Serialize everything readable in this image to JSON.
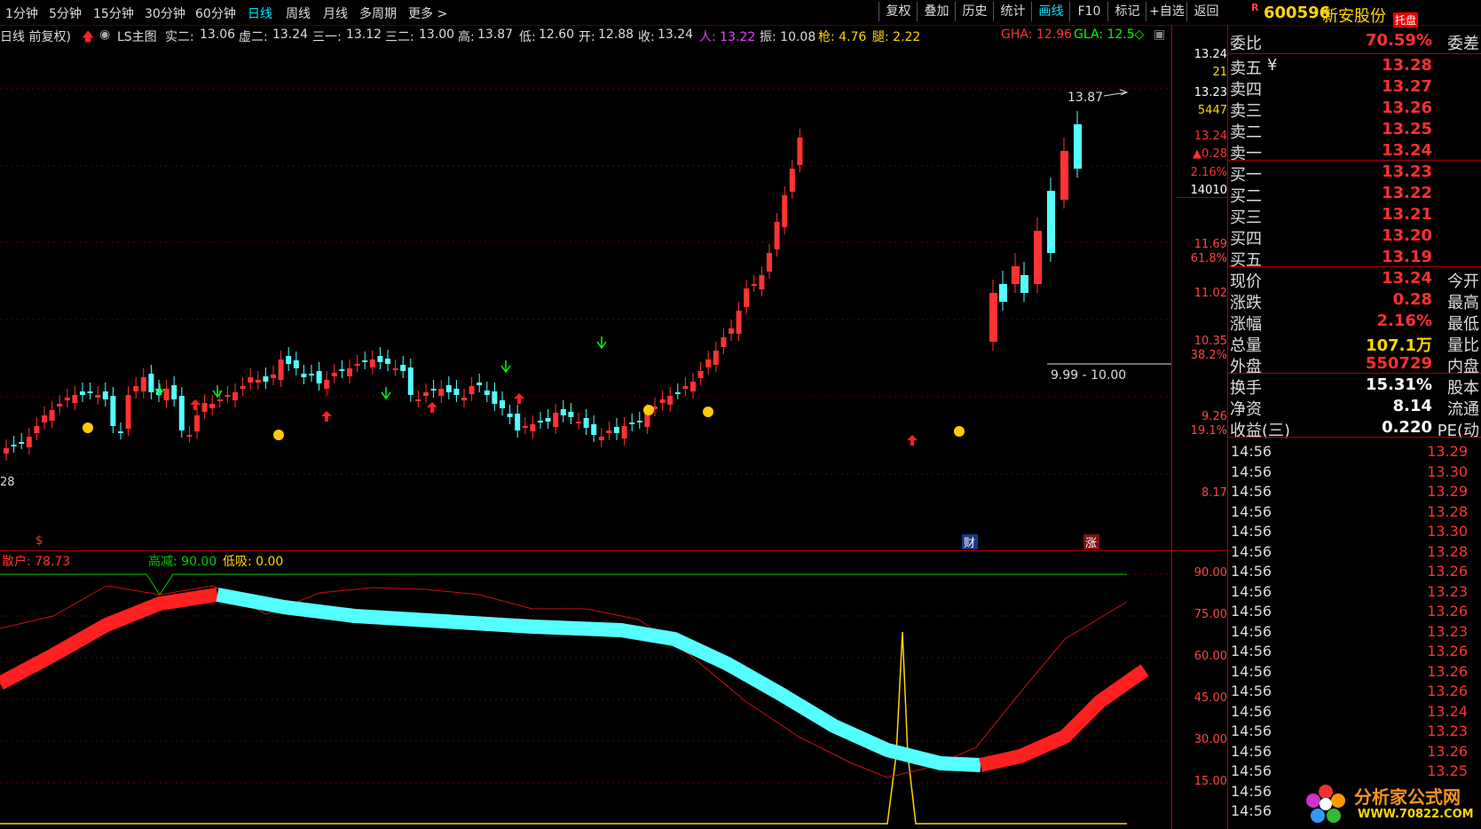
{
  "toolbar": {
    "periods": [
      "1分钟",
      "5分钟",
      "15分钟",
      "30分钟",
      "60分钟",
      "日线",
      "周线",
      "月线",
      "多周期",
      "更多 >"
    ],
    "active_period": "日线",
    "buttons": [
      "复权",
      "叠加",
      "历史",
      "统计",
      "画线",
      "F10",
      "标记",
      "+自选",
      "返回"
    ],
    "active_button": "画线"
  },
  "stock": {
    "badge": "R",
    "code": "600596",
    "name": "新安股份",
    "tag": "托盘"
  },
  "infobar": {
    "prefix": "日线 前复权)",
    "formula": "LS主图",
    "items": [
      {
        "k": "实二:",
        "v": "13.06"
      },
      {
        "k": "虚二:",
        "v": "13.24"
      },
      {
        "k": "三一:",
        "v": "13.12"
      },
      {
        "k": "三二:",
        "v": "13.00"
      },
      {
        "k": "高:",
        "v": "13.87"
      },
      {
        "k": "低:",
        "v": "12.60"
      },
      {
        "k": "开:",
        "v": "12.88"
      },
      {
        "k": "收:",
        "v": "13.24"
      }
    ],
    "ren": "人: 13.22",
    "zhen": "振: 10.08",
    "qiang": "枪: 4.76",
    "tui": "腿: 2.22",
    "gha": "GHA: 12.96",
    "gla": "GLA: 12.5◇"
  },
  "main_axis": {
    "labels": [
      "13.24",
      "21",
      "13.23",
      "5447",
      "13.24",
      "▲0.28",
      "2.16%",
      "14010",
      "11.69",
      "61.8%",
      "11.02",
      "10.35",
      "38.2%",
      "9.26",
      "19.1%",
      "8.17"
    ]
  },
  "annotations": {
    "high": "13.87",
    "range": "9.99 - 10.00",
    "left_edge": "28",
    "cai": "财",
    "zhang": "涨",
    "dollar": "$"
  },
  "indicator": {
    "sanhu": "散户: 78.73",
    "gaojian": "高减: 90.00",
    "dixi": "低吸: 0.00",
    "axis": [
      "90.00",
      "75.00",
      "60.00",
      "45.00",
      "30.00",
      "15.00"
    ]
  },
  "orderbook": {
    "weibi": {
      "label": "委比",
      "value": "70.59%",
      "label2": "委差"
    },
    "asks": [
      {
        "label": "卖五",
        "value": "13.28"
      },
      {
        "label": "卖四",
        "value": "13.27"
      },
      {
        "label": "卖三",
        "value": "13.26"
      },
      {
        "label": "卖二",
        "value": "13.25"
      },
      {
        "label": "卖一",
        "value": "13.24"
      }
    ],
    "bids": [
      {
        "label": "买一",
        "value": "13.23"
      },
      {
        "label": "买二",
        "value": "13.22"
      },
      {
        "label": "买三",
        "value": "13.21"
      },
      {
        "label": "买四",
        "value": "13.20"
      },
      {
        "label": "买五",
        "value": "13.19"
      }
    ]
  },
  "quote": [
    {
      "label": "现价",
      "value": "13.24",
      "label2": "今开",
      "color": "#ff3030"
    },
    {
      "label": "涨跌",
      "value": "0.28",
      "label2": "最高",
      "color": "#ff3030"
    },
    {
      "label": "涨幅",
      "value": "2.16%",
      "label2": "最低",
      "color": "#ff3030"
    },
    {
      "label": "总量",
      "value": "107.1万",
      "label2": "量比",
      "color": "#ffd700"
    },
    {
      "label": "外盘",
      "value": "550729",
      "label2": "内盘",
      "color": "#ff3030"
    }
  ],
  "fund": [
    {
      "label": "换手",
      "value": "15.31%",
      "label2": "股本",
      "color": "#ffffff"
    },
    {
      "label": "净资",
      "value": "8.14",
      "label2": "流通",
      "color": "#ffffff"
    },
    {
      "label": "收益(三)",
      "value": "0.220",
      "label2": "PE(动",
      "color": "#ffffff"
    }
  ],
  "ticks": [
    {
      "t": "14:56",
      "p": "13.29"
    },
    {
      "t": "14:56",
      "p": "13.30"
    },
    {
      "t": "14:56",
      "p": "13.29"
    },
    {
      "t": "14:56",
      "p": "13.28"
    },
    {
      "t": "14:56",
      "p": "13.30"
    },
    {
      "t": "14:56",
      "p": "13.28"
    },
    {
      "t": "14:56",
      "p": "13.26"
    },
    {
      "t": "14:56",
      "p": "13.23"
    },
    {
      "t": "14:56",
      "p": "13.26"
    },
    {
      "t": "14:56",
      "p": "13.23"
    },
    {
      "t": "14:56",
      "p": "13.26"
    },
    {
      "t": "14:56",
      "p": "13.26"
    },
    {
      "t": "14:56",
      "p": "13.26"
    },
    {
      "t": "14:56",
      "p": "13.24"
    },
    {
      "t": "14:56",
      "p": "13.23"
    },
    {
      "t": "14:56",
      "p": "13.26"
    },
    {
      "t": "14:56",
      "p": "13.25"
    },
    {
      "t": "14:56",
      "p": ""
    },
    {
      "t": "14:56",
      "p": ""
    }
  ],
  "watermark": {
    "cn": "分析家公式网",
    "url": "WWW.70822.COM"
  }
}
